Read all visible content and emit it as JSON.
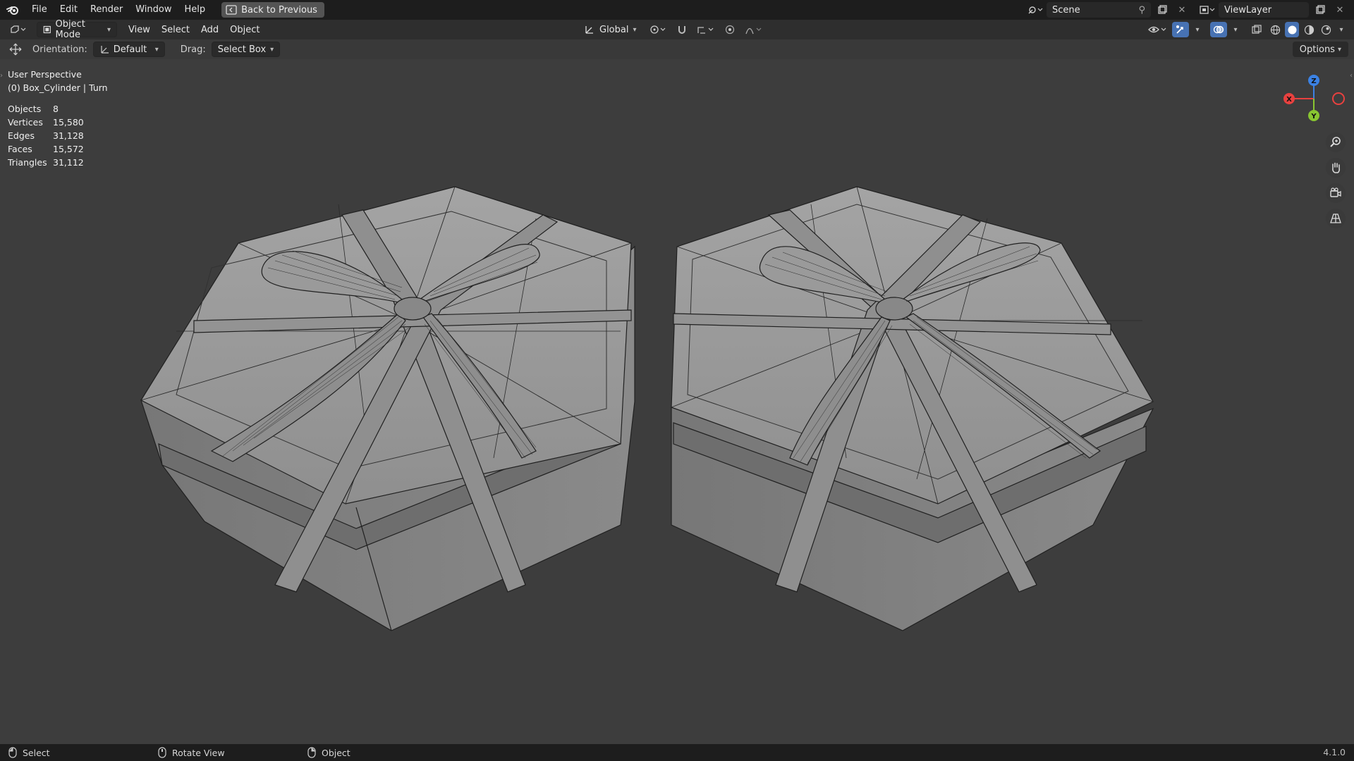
{
  "menubar": {
    "items": [
      "File",
      "Edit",
      "Render",
      "Window",
      "Help"
    ],
    "back_button": "Back to Previous",
    "scene_value": "Scene",
    "viewlayer_value": "ViewLayer"
  },
  "header": {
    "mode": "Object Mode",
    "menus": [
      "View",
      "Select",
      "Add",
      "Object"
    ],
    "transform_orientation": "Global"
  },
  "toolsettings": {
    "orientation_label": "Orientation:",
    "orientation_value": "Default",
    "drag_label": "Drag:",
    "drag_value": "Select Box",
    "options_label": "Options"
  },
  "viewport": {
    "perspective": "User Perspective",
    "object_info": "(0) Box_Cylinder | Turn",
    "stats": [
      {
        "label": "Objects",
        "value": "8"
      },
      {
        "label": "Vertices",
        "value": "15,580"
      },
      {
        "label": "Edges",
        "value": "31,128"
      },
      {
        "label": "Faces",
        "value": "15,572"
      },
      {
        "label": "Triangles",
        "value": "31,112"
      }
    ],
    "gizmo": {
      "x": "X",
      "y": "Y",
      "z": "Z"
    }
  },
  "statusbar": {
    "select": "Select",
    "rotate": "Rotate View",
    "object": "Object",
    "version": "4.1.0"
  },
  "colors": {
    "axis_x": "#e8413f",
    "axis_y": "#89c631",
    "axis_z": "#3b82e4",
    "accent": "#4772b3"
  }
}
